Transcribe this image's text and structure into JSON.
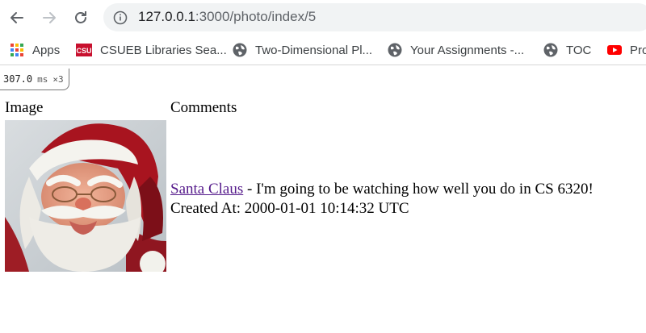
{
  "browser": {
    "url_host": "127.0.0.1",
    "url_rest": ":3000/photo/index/5"
  },
  "bookmarks": [
    {
      "label": "Apps",
      "icon": "apps-grid-icon"
    },
    {
      "label": "CSUEB Libraries Sea...",
      "icon": "csu-logo-icon"
    },
    {
      "label": "Two-Dimensional Pl...",
      "icon": "globe-icon"
    },
    {
      "label": "Your Assignments -...",
      "icon": "globe-icon"
    },
    {
      "label": "TOC",
      "icon": "globe-icon"
    },
    {
      "label": "Pro",
      "icon": "youtube-icon"
    }
  ],
  "csu_logo_text": "CSU",
  "perf": {
    "time": "307.0",
    "unit": "ms",
    "count": "×3"
  },
  "table": {
    "header_image": "Image",
    "header_comments": "Comments"
  },
  "comment": {
    "author": "Santa Claus",
    "text": " - I'm going to be watching how well you do in CS 6320!",
    "created_at": "Created At: 2000-01-01 10:14:32 UTC"
  },
  "colors": {
    "link": "#551a8b",
    "omnibox_bg": "#f1f3f4",
    "youtube_red": "#ff0000",
    "csu_red": "#c8102e"
  }
}
